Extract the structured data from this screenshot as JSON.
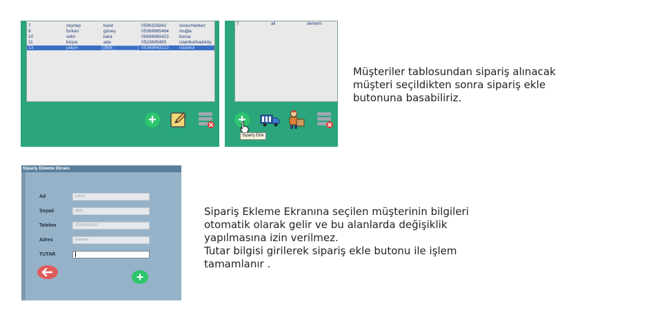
{
  "customers_table": {
    "rows": [
      {
        "id": "7",
        "first": "zeynep",
        "last": "bulut",
        "phone": "0596325842",
        "address": "sivas/merkez"
      },
      {
        "id": "8",
        "first": "furkan",
        "last": "güneş",
        "phone": "05369865464",
        "address": "muğla"
      },
      {
        "id": "10",
        "first": "selin",
        "last": "kara",
        "phone": "05698965423",
        "address": "bursa"
      },
      {
        "id": "11",
        "first": "büşra",
        "last": "ada",
        "phone": "0523695465",
        "address": "istanbul/kadıköy"
      },
      {
        "id": "13",
        "first": "yalçın",
        "last": "dilek",
        "phone": "05369843213",
        "address": "istanbul",
        "selected": true
      }
    ]
  },
  "orders_table": {
    "rows": [
      {
        "id": "7",
        "first": "ali",
        "last": "demem"
      }
    ]
  },
  "toolbar_customers": {
    "add_icon": "plus-icon",
    "edit_icon": "edit-icon",
    "delete_icon": "delete-table-icon"
  },
  "toolbar_orders": {
    "add_icon": "plus-icon",
    "tooltip": "Sipariş Ekle",
    "truck_icon": "truck-icon",
    "courier_icon": "courier-icon",
    "delete_icon": "delete-table-icon"
  },
  "form": {
    "title": "Sipariş Ekleme Ekranı",
    "fields": [
      {
        "label": "Ad",
        "value": "yalçın"
      },
      {
        "label": "Soyad",
        "value": "dilek"
      },
      {
        "label": "Telefon",
        "value": "05369843213"
      },
      {
        "label": "Adres",
        "value": "istanbul"
      },
      {
        "label": "TUTAR",
        "value": ""
      }
    ]
  },
  "descriptions": {
    "top": [
      "Müşteriler tablosundan sipariş alınacak",
      "müşteri seçildikten sonra sipariş ekle",
      "butonuna basabiliriz."
    ],
    "bottom": [
      "Sipariş Ekleme Ekranına seçilen müşterinin bilgileri",
      "otomatik olarak gelir ve bu alanlarda değişiklik",
      "yapılmasına izin verilmez.",
      "Tutar bilgisi girilerek sipariş ekle butonu ile işlem",
      "tamamlanır ."
    ]
  },
  "colors": {
    "panel_green": "#2aa57c",
    "form_bg": "#96b2c8",
    "selection_blue": "#3b6fc4",
    "plus_green": "#2ec56f",
    "back_red": "#e05a5a"
  }
}
